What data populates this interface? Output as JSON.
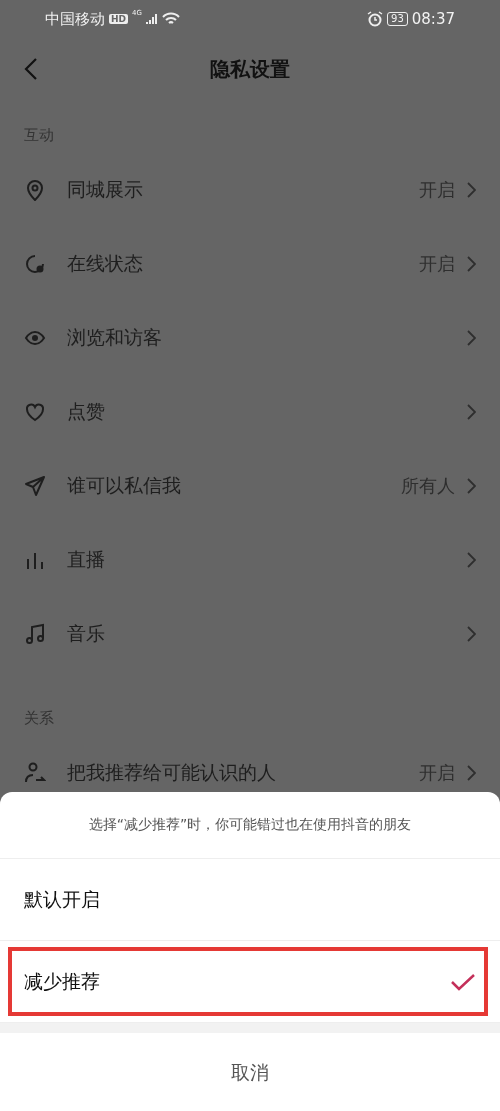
{
  "status_bar": {
    "carrier": "中国移动",
    "hd_badge": "HD",
    "network": "4G",
    "battery": "93",
    "time": "08:37"
  },
  "header": {
    "title": "隐私设置"
  },
  "sections": [
    {
      "title": "互动",
      "items": [
        {
          "kind": "pin",
          "label": "同城展示",
          "value": "开启"
        },
        {
          "kind": "status",
          "label": "在线状态",
          "value": "开启"
        },
        {
          "kind": "eye",
          "label": "浏览和访客"
        },
        {
          "kind": "heart",
          "label": "点赞"
        },
        {
          "kind": "plane",
          "label": "谁可以私信我",
          "value": "所有人"
        },
        {
          "kind": "bars",
          "label": "直播"
        },
        {
          "kind": "music",
          "label": "音乐"
        }
      ]
    },
    {
      "title": "关系",
      "items": [
        {
          "kind": "person",
          "label": "把我推荐给可能认识的人",
          "value": "开启"
        }
      ]
    }
  ],
  "sheet": {
    "hint": "选择“减少推荐”时，你可能错过也在使用抖音的朋友",
    "options": [
      {
        "label": "默认开启",
        "selected": false,
        "highlighted": false
      },
      {
        "label": "减少推荐",
        "selected": true,
        "highlighted": true
      }
    ],
    "cancel": "取消"
  }
}
